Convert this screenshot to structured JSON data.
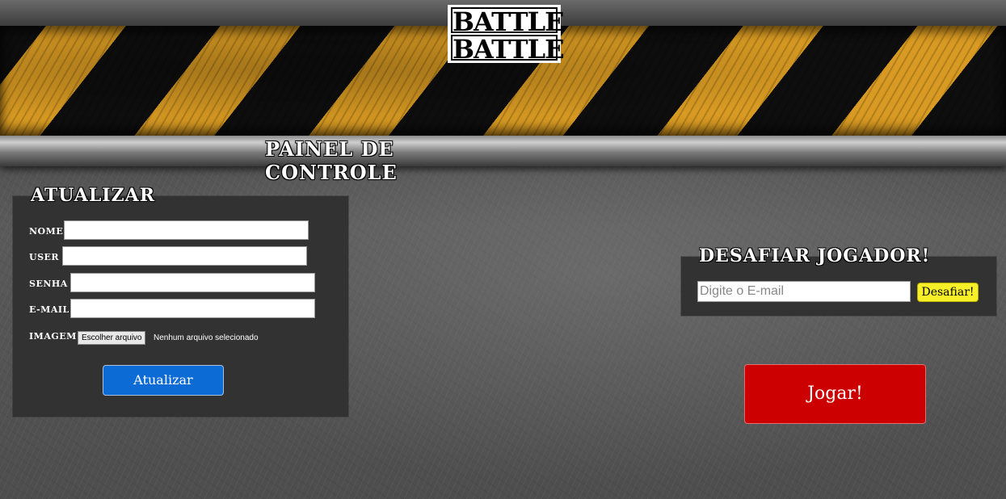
{
  "header": {
    "logo_line1": "BATTLE",
    "logo_line2": "BATTLE",
    "page_title": "PAINEL DE CONTROLE"
  },
  "update_form": {
    "title": "ATUALIZAR",
    "fields": [
      {
        "label": "NOME",
        "value": ""
      },
      {
        "label": "USER",
        "value": ""
      },
      {
        "label": "SENHA",
        "value": ""
      },
      {
        "label": "E-MAIL",
        "value": ""
      }
    ],
    "image_label": "IMAGEM",
    "file_button": "Escolher arquivo",
    "file_status": "Nenhum arquivo selecionado",
    "submit_label": "Atualizar"
  },
  "challenge": {
    "title": "DESAFIAR JOGADOR!",
    "email_placeholder": "Digite o E-mail",
    "button_label": "Desafiar!"
  },
  "play": {
    "button_label": "Jogar!"
  },
  "colors": {
    "hazard_yellow": "#d89a22",
    "panel_bg": "#323232",
    "update_button": "#0d6bd6",
    "challenge_button": "#f7f028",
    "play_button": "#cc0000"
  }
}
